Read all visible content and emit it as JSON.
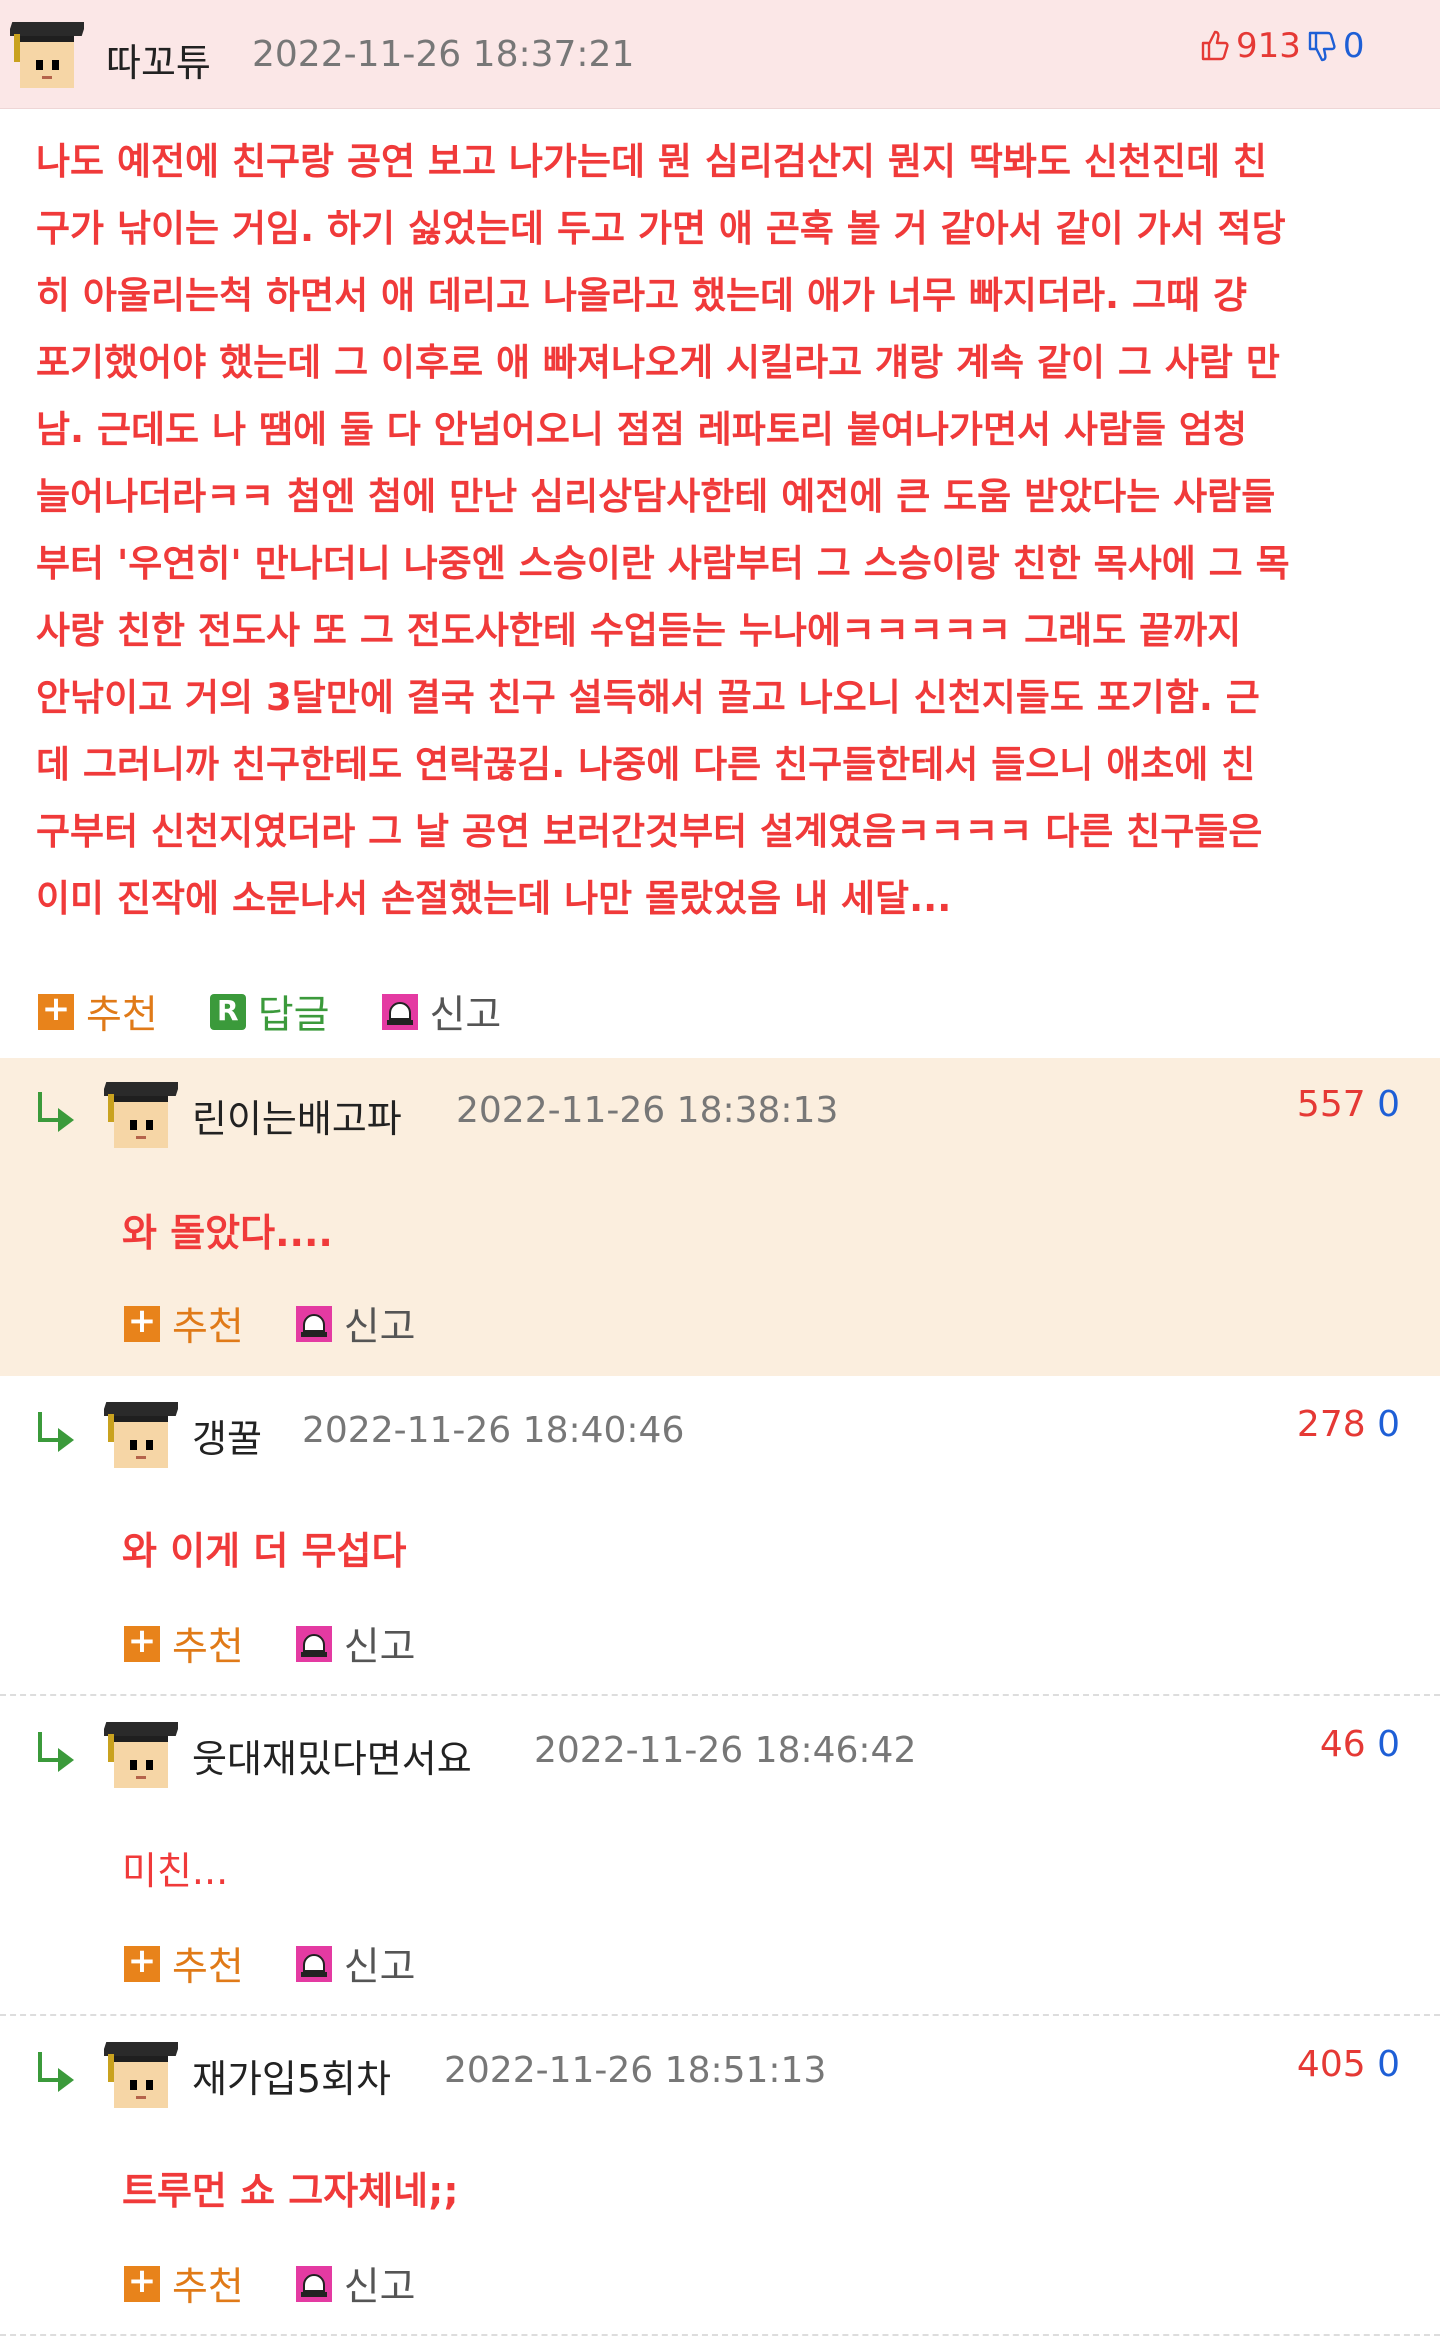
{
  "main": {
    "nickname": "따꼬튜",
    "date": "2022-11-26 18:37:21",
    "up": "913",
    "down": "0",
    "lines": [
      "나도 예전에 친구랑 공연 보고 나가는데 뭔 심리검산지 뭔지 딱봐도 신천진데 친",
      "구가 낚이는 거임. 하기 싫었는데 두고 가면 애 곤혹 볼 거 같아서 같이 가서 적당",
      "히 아울리는척 하면서 애 데리고 나올라고 했는데 애가 너무 빠지더라. 그때 걍",
      "포기했어야 했는데 그 이후로 애 빠져나오게 시킬라고 걔랑 계속 같이 그 사람 만",
      "남. 근데도 나 땜에 둘 다 안넘어오니 점점 레파토리 붙여나가면서 사람들 엄청",
      "늘어나더라ㅋㅋ 첨엔 첨에 만난 심리상담사한테 예전에 큰 도움 받았다는 사람들",
      "부터 '우연히' 만나더니 나중엔 스승이란 사람부터 그 스승이랑 친한 목사에 그 목",
      "사랑 친한 전도사 또 그 전도사한테 수업듣는 누나에ㅋㅋㅋㅋㅋ 그래도 끝까지",
      "안낚이고 거의 3달만에 결국 친구 설득해서 끌고 나오니 신천지들도 포기함. 근",
      "데 그러니까 친구한테도 연락끊김. 나중에 다른 친구들한테서 들으니 애초에 친",
      "구부터 신천지였더라 그 날 공연 보러간것부터 설계였음ㅋㅋㅋㅋ 다른 친구들은",
      "이미 진작에 소문나서 손절했는데 나만 몰랐었음 내 세달..."
    ],
    "actions": {
      "recommend": "추천",
      "reply": "답글",
      "report": "신고"
    }
  },
  "replies": [
    {
      "nickname": "린이는배고파",
      "date": "2022-11-26 18:38:13",
      "up": "557",
      "down": "0",
      "text": "와 돌았다....",
      "recommend": "추천",
      "report": "신고"
    },
    {
      "nickname": "갱꿀",
      "date": "2022-11-26 18:40:46",
      "up": "278",
      "down": "0",
      "text": "와 이게 더 무섭다",
      "recommend": "추천",
      "report": "신고"
    },
    {
      "nickname": "웃대재밌다면서요",
      "date": "2022-11-26 18:46:42",
      "up": "46",
      "down": "0",
      "text": "미친...",
      "recommend": "추천",
      "report": "신고"
    },
    {
      "nickname": "재가입5회차",
      "date": "2022-11-26 18:51:13",
      "up": "405",
      "down": "0",
      "text": "트루먼 쇼 그자체네;;",
      "recommend": "추천",
      "report": "신고"
    }
  ],
  "colors": {
    "up": "#e53935",
    "down": "#1e5fd6",
    "comment_text": "#f03a3a",
    "highlight_bg": "#fbeede",
    "main_head_bg": "#fbe7e7"
  },
  "icons": [
    "thumbs-up-icon",
    "thumbs-down-icon",
    "plus-icon",
    "reply-r-icon",
    "siren-icon",
    "reply-arrow-icon",
    "graduate-avatar"
  ]
}
